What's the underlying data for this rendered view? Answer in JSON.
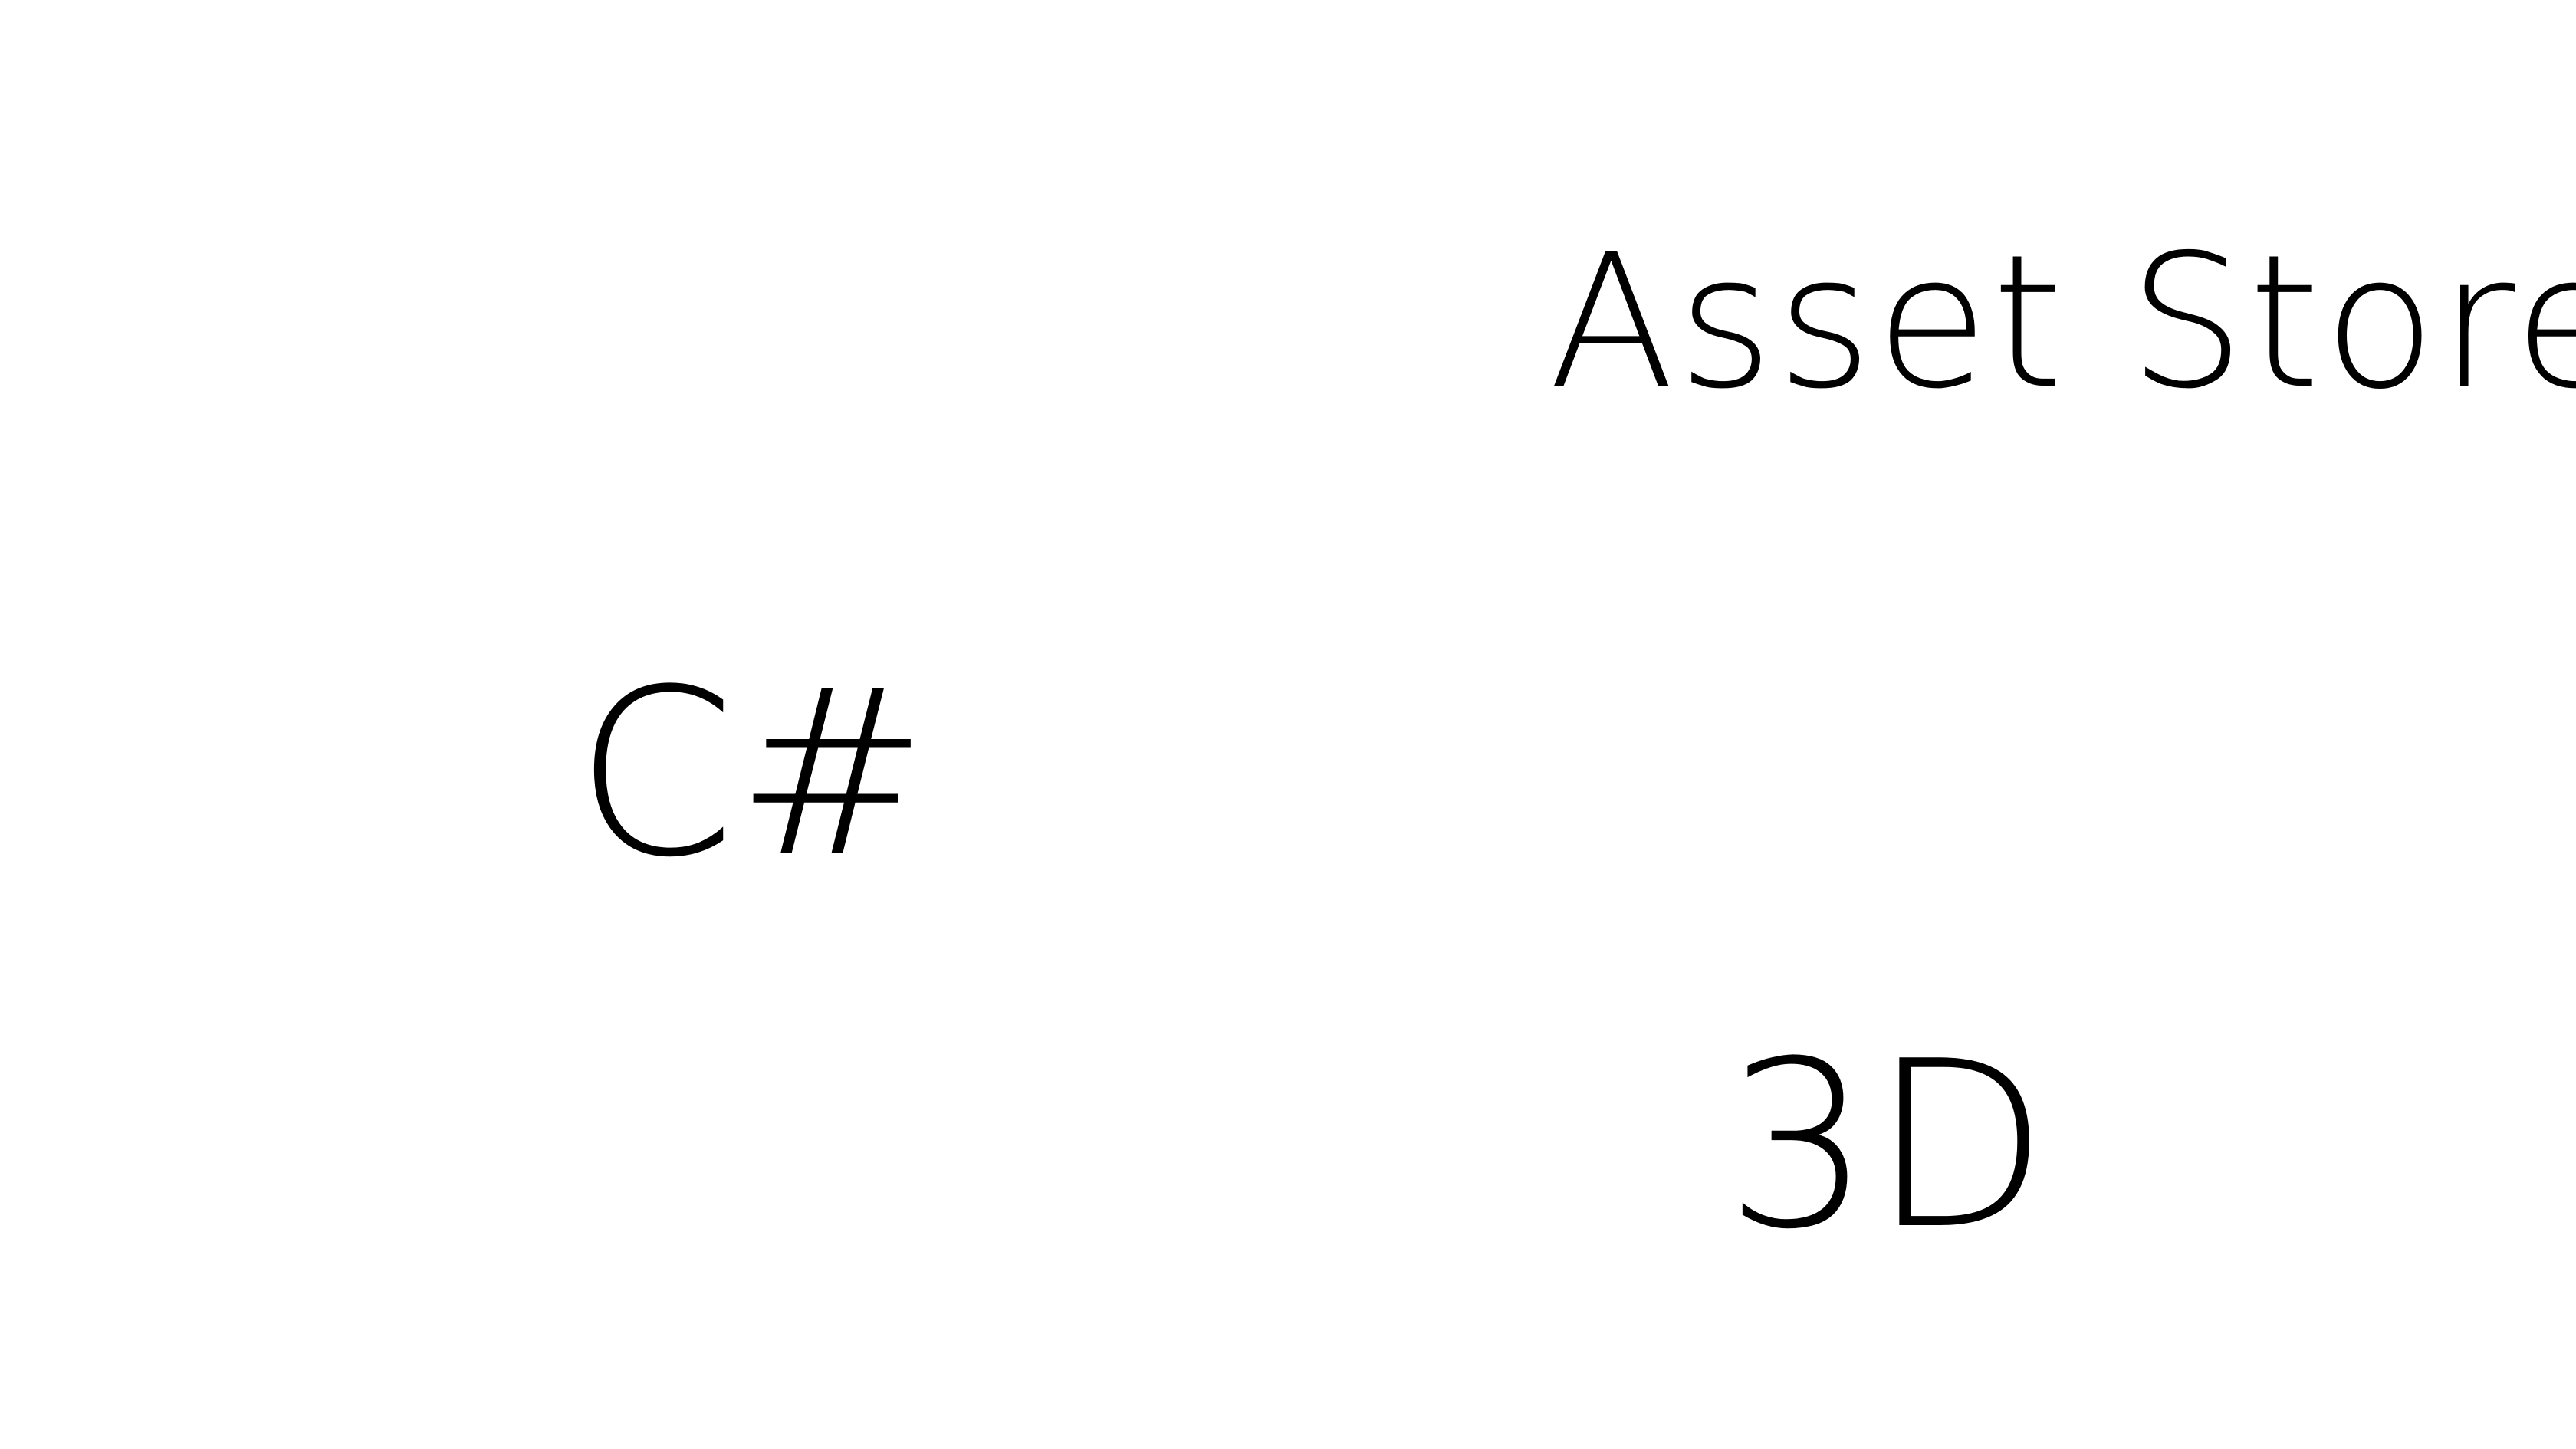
{
  "slide": {
    "words": {
      "asset_store": "Asset Store",
      "csharp": "C#",
      "three_d": "3D"
    },
    "colors": {
      "background": "#ffffff",
      "text": "#000000"
    }
  }
}
